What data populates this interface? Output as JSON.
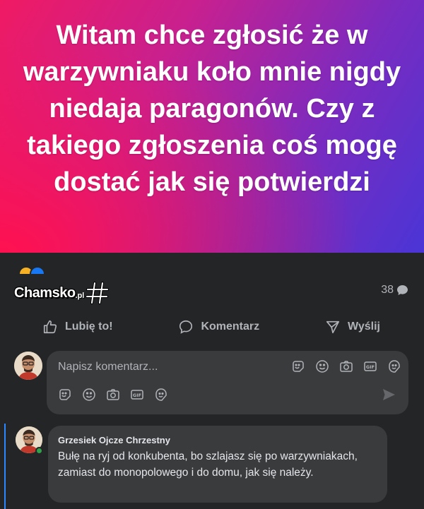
{
  "post": {
    "text": "Witam chce zgłosić że w warzywniaku koło mnie nigdy niedaja paragonów. Czy z takiego zgłoszenia coś mogę dostać jak się potwierdzi",
    "background_colors": [
      "#ff1150",
      "#c8208f",
      "#4a35d6"
    ]
  },
  "watermark": {
    "brand": "Chamsko",
    "suffix": ".pl"
  },
  "stats": {
    "comment_count": "38"
  },
  "actions": {
    "like_label": "Lubię to!",
    "comment_label": "Komentarz",
    "share_label": "Wyślij"
  },
  "composer": {
    "placeholder": "Napisz komentarz...",
    "icons": [
      "sticker-icon",
      "emoji-icon",
      "camera-icon",
      "gif-icon",
      "avatar-sticker-icon"
    ]
  },
  "comment": {
    "author": "Grzesiek Ojcze Chrzestny",
    "text": "Bułę na ryj od konkubenta, bo szlajasz się po warzywniakach, zamiast do monopolowego i do domu, jak się należy."
  },
  "colors": {
    "background": "#242526",
    "surface": "#3a3b3c",
    "text_primary": "#e4e6eb",
    "text_secondary": "#b0b3b8",
    "accent": "#2d88ff",
    "online": "#31a24c"
  }
}
